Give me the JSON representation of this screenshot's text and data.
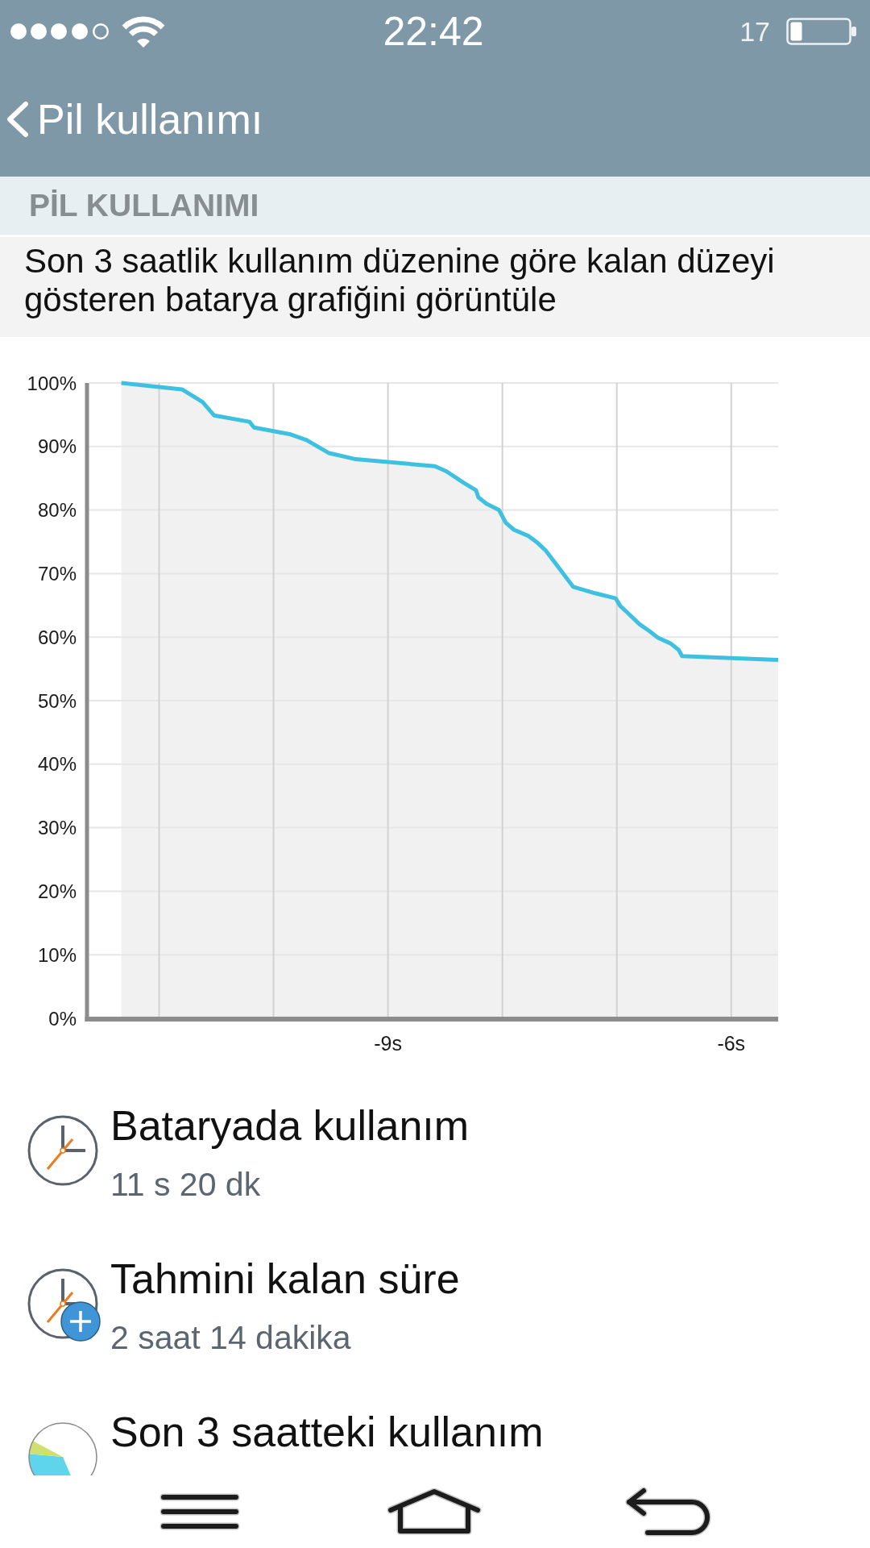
{
  "status_bar": {
    "time": "22:42",
    "battery_text": "17"
  },
  "header": {
    "title": "Pil kullanımı"
  },
  "section": {
    "title": "PİL KULLANIMI",
    "description": "Son 3 saatlik kullanım düzenine göre kalan düzeyi gösteren batarya grafiğini görüntüle"
  },
  "battery_graph": {
    "chart_data": {
      "type": "area",
      "grid": true,
      "xlim": [
        -11.63,
        -5.59
      ],
      "ylim": [
        0,
        100
      ],
      "xticks": [
        {
          "value": -9,
          "label": "-9s"
        },
        {
          "value": -6,
          "label": "-6s"
        }
      ],
      "yticks": [
        {
          "value": 0,
          "label": "0%"
        },
        {
          "value": 10,
          "label": "10%"
        },
        {
          "value": 20,
          "label": "20%"
        },
        {
          "value": 30,
          "label": "30%"
        },
        {
          "value": 40,
          "label": "40%"
        },
        {
          "value": 50,
          "label": "50%"
        },
        {
          "value": 60,
          "label": "60%"
        },
        {
          "value": 70,
          "label": "70%"
        },
        {
          "value": 80,
          "label": "80%"
        },
        {
          "value": 90,
          "label": "90%"
        },
        {
          "value": 100,
          "label": "100%"
        }
      ],
      "x": [
        -11.33,
        -10.8,
        -10.62,
        -10.52,
        -10.21,
        -10.17,
        -9.85,
        -9.71,
        -9.52,
        -9.28,
        -8.59,
        -8.49,
        -8.34,
        -8.23,
        -8.21,
        -8.14,
        -8.03,
        -7.97,
        -7.9,
        -7.77,
        -7.69,
        -7.62,
        -7.38,
        -7.19,
        -7.01,
        -6.97,
        -6.91,
        -6.8,
        -6.72,
        -6.64,
        -6.53,
        -6.46,
        -6.43,
        -6,
        -5.59
      ],
      "series": [
        {
          "color": "#3ec1e0",
          "values": [
            100,
            99,
            97,
            94.9,
            93.9,
            93,
            91.9,
            91,
            89,
            88,
            86.9,
            86.1,
            84.3,
            83.1,
            82,
            81,
            80,
            78,
            76.9,
            75.9,
            74.8,
            73.6,
            67.9,
            66.9,
            66.1,
            64.9,
            63.9,
            62,
            61,
            59.9,
            59,
            58,
            57,
            56.7,
            56.4
          ]
        }
      ]
    }
  },
  "items": [
    {
      "kind": "clock",
      "title": "Bataryada kullanım",
      "value": "11 s 20 dk"
    },
    {
      "kind": "clock-plus",
      "title": "Tahmini kalan süre",
      "value": "2 saat 14 dakika"
    },
    {
      "kind": "pie",
      "title": "Son 3 saatteki kullanım"
    }
  ]
}
